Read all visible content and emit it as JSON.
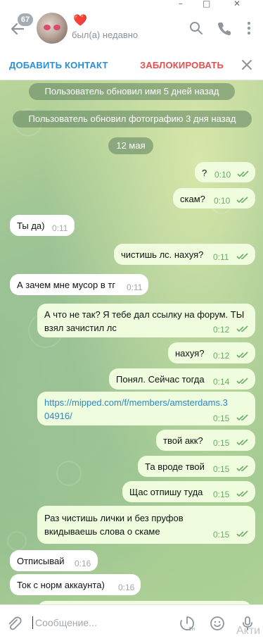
{
  "window": {
    "minimize": "–",
    "maximize": "□",
    "close": "✕"
  },
  "header": {
    "unread_count": "67",
    "contact_name": "❤️",
    "status": "был(а) недавно",
    "icons": [
      "back-arrow-icon",
      "search-icon",
      "phone-icon",
      "more-vertical-icon"
    ]
  },
  "actions": {
    "add_contact": "ДОБАВИТЬ КОНТАКТ",
    "block": "ЗАБЛОКИРОВАТЬ"
  },
  "service": {
    "name_changed": "Пользователь обновил имя 5 дней назад",
    "photo_changed": "Пользователь обновил фотографию 3 дня назад",
    "date": "12 мая"
  },
  "messages": [
    {
      "dir": "out",
      "text": "?",
      "time": "0:10"
    },
    {
      "dir": "out",
      "text": "скам?",
      "time": "0:10"
    },
    {
      "dir": "in",
      "text": "Ты да)",
      "time": "0:11"
    },
    {
      "dir": "out",
      "text": "чистишь лс. нахуя?",
      "time": "0:11"
    },
    {
      "dir": "in",
      "text": "А зачем мне мусор в тг",
      "time": "0:11"
    },
    {
      "dir": "out",
      "line1": "А что не так? Я тебе дал ссылку на форум. ТЫ",
      "line2": "взял зачистил лс",
      "time": "0:12"
    },
    {
      "dir": "out",
      "text": "нахуя?",
      "time": "0:12"
    },
    {
      "dir": "out",
      "text": "Понял. Сейчас тогда",
      "time": "0:14"
    },
    {
      "dir": "out",
      "line1": "https://mipped.com/f/members/amsterdams.3",
      "line2": "04916/",
      "time": "0:15"
    },
    {
      "dir": "out",
      "text": "твой акк?",
      "time": "0:15"
    },
    {
      "dir": "out",
      "text": "Та вроде твой",
      "time": "0:15"
    },
    {
      "dir": "out",
      "text": "Щас отпишу туда",
      "time": "0:15"
    },
    {
      "dir": "out",
      "line1": "Раз чистишь лички и без пруфов",
      "line2": "вкидываешь слова о скаме",
      "time": "0:15"
    },
    {
      "dir": "in",
      "text": "Отписывай",
      "time": "0:16"
    },
    {
      "dir": "in",
      "text": "Ток с норм аккаунта)",
      "time": "0:16"
    }
  ],
  "input": {
    "placeholder": "Сообщение...",
    "watermark": "Акти"
  },
  "colors": {
    "accent": "#2b8fd5",
    "danger": "#e0524f",
    "outgoing_bubble": "#effdde",
    "incoming_bubble": "#ffffff",
    "tick": "#6cac6a"
  }
}
